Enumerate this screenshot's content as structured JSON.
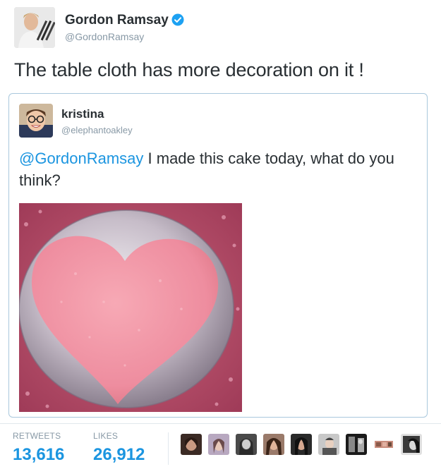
{
  "tweet": {
    "author": {
      "name": "Gordon Ramsay",
      "handle": "@GordonRamsay",
      "verified": true,
      "avatar_icon": "chef-portrait-avatar"
    },
    "text": "The table cloth has more decoration on it !",
    "quoted": {
      "author": {
        "name": "kristina",
        "handle": "@elephantoakley",
        "avatar_icon": "glasses-selfie-avatar"
      },
      "mention": "@GordonRamsay",
      "text": " I made this cake today, what do you think?",
      "image_icon": "pink-heart-cake-photo"
    },
    "stats": {
      "retweets_label": "RETWEETS",
      "retweets_value": "13,616",
      "likes_label": "LIKES",
      "likes_value": "26,912"
    },
    "likers_count": 9
  },
  "colors": {
    "link": "#1b95e0",
    "muted": "#8899a6",
    "text": "#292f33",
    "quote_border": "#a9c8dd",
    "verified": "#1da1f2"
  }
}
